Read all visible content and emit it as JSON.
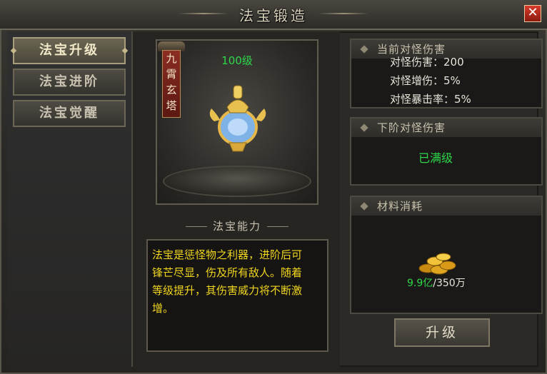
{
  "window": {
    "title": "法宝锻造"
  },
  "sidebar": {
    "items": [
      {
        "label": "法宝升级",
        "active": true
      },
      {
        "label": "法宝进阶",
        "active": false
      },
      {
        "label": "法宝觉醒",
        "active": false
      }
    ]
  },
  "preview": {
    "level_label": "100级",
    "banner": [
      "九",
      "霄",
      "玄",
      "塔"
    ]
  },
  "ability": {
    "section_title": "法宝能力",
    "description_lines": [
      "法宝是惩怪物之利器，进阶后可",
      "锋芒尽显，伤及所有敌人。随着",
      "等级提升，其伤害威力将不断激",
      "增。"
    ]
  },
  "current_damage": {
    "title": "当前对怪伤害",
    "stats": [
      "对怪伤害：200",
      "对怪增伤：5%",
      "对怪暴击率：5%"
    ]
  },
  "next_damage": {
    "title": "下阶对怪伤害",
    "status": "已满级"
  },
  "materials": {
    "title": "材料消耗",
    "owned": "9.9亿",
    "required": "/350万"
  },
  "upgrade_button": "升级",
  "colors": {
    "level_green": "#2dd84a",
    "description_yellow": "#f0d61e",
    "close_red": "#c8301f"
  }
}
